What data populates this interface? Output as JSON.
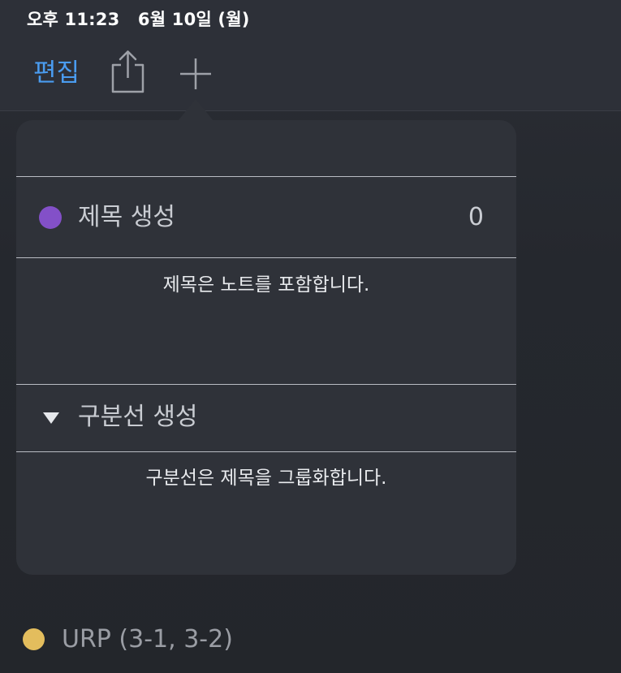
{
  "status_bar": {
    "datetime": "오후 11:23   6월 10일 (월)"
  },
  "toolbar": {
    "edit_label": "편집",
    "share_icon": "share-icon",
    "add_icon": "plus-icon",
    "accent_color": "#4a9cf0"
  },
  "popover": {
    "create_title": {
      "label": "제목 생성",
      "count": "0",
      "dot_color": "#8350c8",
      "description": "제목은 노트를 포함합니다."
    },
    "create_divider": {
      "label": "구분선 생성",
      "icon": "triangle-down-icon",
      "description": "구분선은 제목을 그룹화합니다."
    }
  },
  "list": {
    "items": [
      {
        "label": "URP (3-1, 3-2)",
        "dot_color": "#e3bd5d"
      }
    ]
  }
}
